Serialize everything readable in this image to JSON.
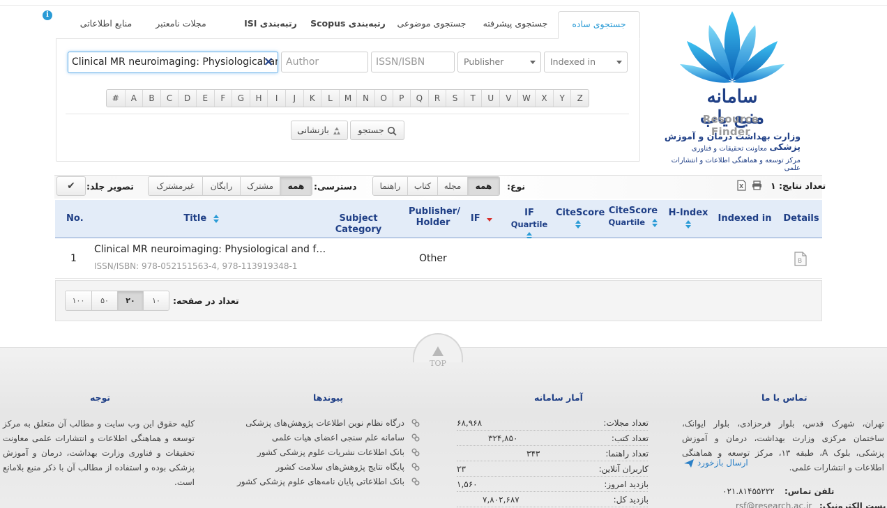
{
  "tabs": [
    {
      "label": "جستجوی ساده",
      "active": true
    },
    {
      "label": "جستجوی پیشرفته",
      "active": false
    },
    {
      "label": "جستجوی موضوعی",
      "active": false
    },
    {
      "label": "رتبه‌بندی Scopus",
      "active": false
    },
    {
      "label": "رتبه‌بندی ISI",
      "active": false
    },
    {
      "label": "مجلات نامعتبر",
      "active": false
    },
    {
      "label": "منابع اطلاعاتی",
      "active": false
    }
  ],
  "logo": {
    "title_fa": "سامانه منبع یاب",
    "title_en": "Resource Finder",
    "ministry": "وزارت بهداشت درمان و آموزش پزشکی",
    "deputy": "معاونت تحقیقات و فناوری",
    "center": "مرکز توسعه و هماهنگی اطلاعات و انتشارات علمی"
  },
  "search": {
    "title_value": "Clinical MR neuroimaging: Physiological and",
    "author_placeholder": "Author",
    "issn_placeholder": "ISSN/ISBN",
    "publisher_value": "Publisher",
    "indexed_value": "Indexed in",
    "search_label": "جستجو",
    "reset_label": "بازنشانی"
  },
  "alphabet": [
    "#",
    "A",
    "B",
    "C",
    "D",
    "E",
    "F",
    "G",
    "H",
    "I",
    "J",
    "K",
    "L",
    "M",
    "N",
    "O",
    "P",
    "Q",
    "R",
    "S",
    "T",
    "U",
    "V",
    "W",
    "X",
    "Y",
    "Z"
  ],
  "filters": {
    "result_count_label": "تعداد نتایج: ۱",
    "type_label": "نوع:",
    "type_options": [
      "همه",
      "مجله",
      "کتاب",
      "راهنما"
    ],
    "type_selected": "همه",
    "access_label": "دسترسی:",
    "access_options": [
      "همه",
      "مشترک",
      "رایگان",
      "غیرمشترک"
    ],
    "access_selected": "همه",
    "cover_label": "تصویر جلد:"
  },
  "table": {
    "headers": {
      "no": "No.",
      "title": "Title",
      "subject": "Subject Category",
      "publisher_line1": "Publisher/",
      "publisher_line2": "Holder",
      "if": "IF",
      "if_quartile_1": "IF",
      "if_quartile_2": "Quartile",
      "citescore": "CiteScore",
      "cs_quartile_1": "CiteScore",
      "cs_quartile_2": "Quartile",
      "hindex": "H-Index",
      "indexed": "Indexed in",
      "details": "Details"
    },
    "rows": [
      {
        "no": "1",
        "title": "Clinical MR neuroimaging: Physiological and f…",
        "issn": "ISSN/ISBN: 978-052151563-4, 978-113919348-1",
        "publisher": "Other"
      }
    ]
  },
  "pager": {
    "label": "تعداد در صفحه:",
    "options": [
      "۱۰۰",
      "۵۰",
      "۲۰",
      "۱۰"
    ],
    "selected": "۲۰"
  },
  "footer": {
    "top_label": "TOP",
    "contact": {
      "title": "تماس با ما",
      "address": "تهران، شهرک قدس، بلوار فرحزادی، بلوار ایوانک، ساختمان مرکزی وزارت بهداشت، درمان و آموزش پزشکی، بلوک A، طبقه ۱۳، مرکز توسعه و هماهنگی اطلاعات و انتشارات علمی.",
      "feedback": "ارسال بازخورد",
      "phone_label": "تلفن تماس:",
      "phone": "۰۲۱.۸۱۴۵۵۲۲۲",
      "email_label": "پست الکترونیک:",
      "email": "rsf@research.ac.ir"
    },
    "stats": {
      "title": "آمار سامانه",
      "rows": [
        {
          "label": "تعداد مجلات:",
          "value": "۶۸,۹۶۸"
        },
        {
          "label": "تعداد کتب:",
          "value": "۳۲۴,۸۵۰"
        },
        {
          "label": "تعداد راهنما:",
          "value": "۳۴۳"
        },
        {
          "label": "کاربران آنلاین:",
          "value": "۲۳"
        },
        {
          "label": "بازدید امروز:",
          "value": "۱,۵۶۰"
        },
        {
          "label": "بازدید کل:",
          "value": "۷,۸۰۲,۶۸۷"
        }
      ]
    },
    "links": {
      "title": "پیوندها",
      "items": [
        "درگاه نظام نوین اطلاعات پژوهش‌های پزشکی",
        "سامانه علم سنجی اعضای هیات علمی",
        "بانک اطلاعات نشریات علوم پزشکی کشور",
        "پایگاه نتایج پژوهش‌های سلامت کشور",
        "بانک اطلاعاتی پایان نامه‌های علوم پزشکی کشور"
      ]
    },
    "notice": {
      "title": "توجه",
      "text": "کلیه حقوق این وب سایت و مطالب آن متعلق به مرکز توسعه و هماهنگی اطلاعات و انتشارات علمی معاونت تحقیقات و فناوری وزارت بهداشت، درمان و آموزش پزشکی بوده و استفاده از مطالب آن با ذکر منبع بلامانع است."
    }
  },
  "colors": {
    "accent": "#2a9bd6",
    "navy": "#1f3f86",
    "header_bg": "#e3ecf8"
  }
}
